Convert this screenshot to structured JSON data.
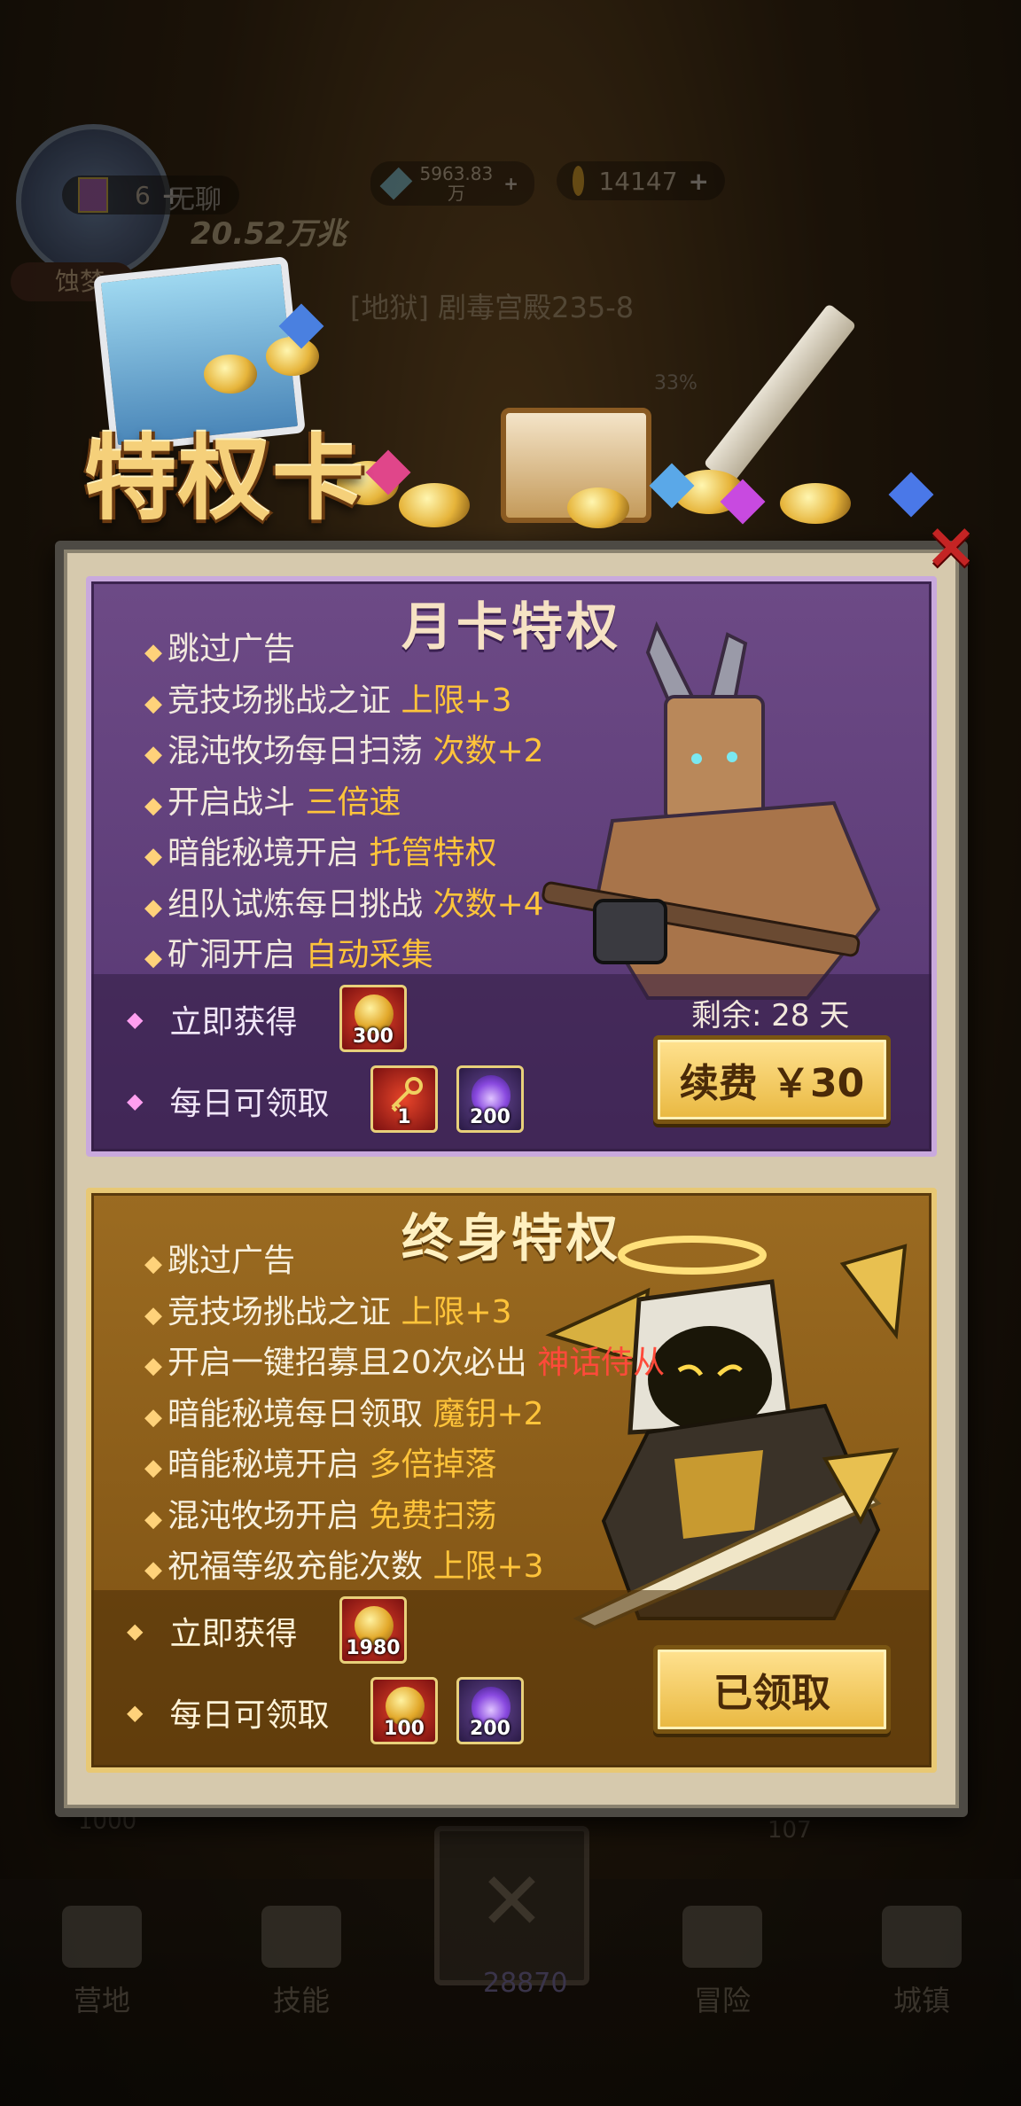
{
  "hud": {
    "player_name": "无聊",
    "power": "20.52万兆",
    "card_count": "6",
    "crystal": "5963.83",
    "crystal_unit": "万",
    "gold": "14147",
    "tag": "蚀梦",
    "stage": "[地狱] 剧毒宫殿235-8",
    "progress": "33%",
    "bottom_left_num": "1000",
    "bottom_right_num": "107"
  },
  "nav": {
    "items": [
      "营地",
      "技能",
      "冒险",
      "城镇"
    ],
    "center_value": "28870"
  },
  "popup": {
    "title": "特权卡",
    "close_icon": "×"
  },
  "monthly": {
    "title": "月卡特权",
    "perks": [
      {
        "key": "跳过广告",
        "hl": ""
      },
      {
        "key": "竞技场挑战之证 ",
        "hl": "上限+3"
      },
      {
        "key": "混沌牧场每日扫荡 ",
        "hl": "次数+2"
      },
      {
        "key": "开启战斗 ",
        "hl": "三倍速"
      },
      {
        "key": "暗能秘境开启 ",
        "hl": "托管特权"
      },
      {
        "key": "组队试炼每日挑战 ",
        "hl": "次数+4"
      },
      {
        "key": "矿洞开启 ",
        "hl": "自动采集"
      }
    ],
    "instant_label": "立即获得",
    "instant_qty": "300",
    "daily_label": "每日可领取",
    "daily_qty_1": "1",
    "daily_qty_2": "200",
    "remaining": "剩余: 28 天",
    "button": "续费 ￥30"
  },
  "lifetime": {
    "title": "终身特权",
    "perks": [
      {
        "key": "跳过广告",
        "hl": ""
      },
      {
        "key": "竞技场挑战之证 ",
        "hl": "上限+3"
      },
      {
        "key": "开启一键招募且20次必出 ",
        "hl": "",
        "red": "神话侍从"
      },
      {
        "key": "暗能秘境每日领取 ",
        "hl": "魔钥+2"
      },
      {
        "key": "暗能秘境开启 ",
        "hl": "多倍掉落"
      },
      {
        "key": "混沌牧场开启 ",
        "hl": "免费扫荡"
      },
      {
        "key": "祝福等级充能次数 ",
        "hl": "上限+3"
      }
    ],
    "instant_label": "立即获得",
    "instant_qty": "1980",
    "daily_label": "每日可领取",
    "daily_qty_1": "100",
    "daily_qty_2": "200",
    "button": "已领取"
  },
  "colors": {
    "monthly_bg": "#5f3f7b",
    "lifetime_bg": "#8c5e1a",
    "highlight": "#ffc43a",
    "red_highlight": "#ff4a3a",
    "button_gold": "#f0c85a"
  }
}
